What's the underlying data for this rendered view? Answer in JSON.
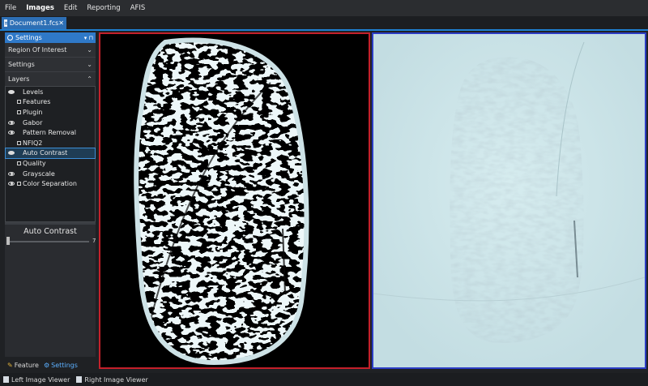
{
  "menu": [
    "File",
    "Images",
    "Edit",
    "Reporting",
    "AFIS"
  ],
  "document_tab": {
    "title": "Document1.fcs",
    "close": "✕"
  },
  "sidebar": {
    "panel_title": "Settings",
    "panel_controls": "▾ ⊓",
    "sections": [
      "Region Of Interest",
      "Settings"
    ],
    "layers_title": "Layers",
    "layers": [
      {
        "label": "Levels",
        "eye": true,
        "checkbox": false,
        "selected": false
      },
      {
        "label": "Features",
        "eye": false,
        "checkbox": true,
        "selected": false
      },
      {
        "label": "Plugin",
        "eye": false,
        "checkbox": true,
        "selected": false
      },
      {
        "label": "Gabor",
        "eye": true,
        "checkbox": false,
        "selected": false
      },
      {
        "label": "Pattern Removal",
        "eye": true,
        "checkbox": false,
        "selected": false
      },
      {
        "label": "NFIQ2",
        "eye": false,
        "checkbox": true,
        "selected": false
      },
      {
        "label": "Auto Contrast",
        "eye": true,
        "checkbox": false,
        "selected": true
      },
      {
        "label": "Quality",
        "eye": false,
        "checkbox": true,
        "selected": false
      },
      {
        "label": "Grayscale",
        "eye": true,
        "checkbox": false,
        "selected": false
      },
      {
        "label": "Color Separation",
        "eye": true,
        "checkbox": true,
        "selected": false
      }
    ],
    "active_layer_title": "Auto Contrast",
    "slider_value": "7",
    "slider_level": 0
  },
  "bottom_tabs": [
    "Feature",
    "Settings"
  ],
  "status_tabs": [
    "Left Image Viewer",
    "Right Image Viewer"
  ],
  "colors": {
    "accent": "#2f79c8",
    "left_frame": "#c4202a",
    "right_frame": "#2b3cc4"
  }
}
